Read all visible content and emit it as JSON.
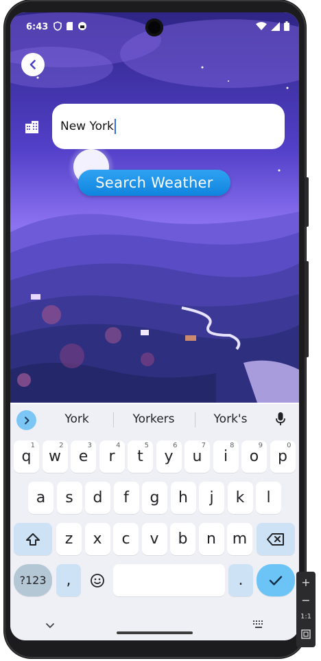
{
  "status_bar": {
    "time": "6:43",
    "left_icons": [
      "shield-icon",
      "sd-card-icon",
      "app-circle-icon"
    ],
    "right_icons": [
      "wifi-icon",
      "signal-icon",
      "battery-icon"
    ]
  },
  "app": {
    "city_input": {
      "value": "New York",
      "placeholder": ""
    },
    "search_button_label": "Search Weather",
    "colors": {
      "button": "#1a93e8",
      "sky_top": "#3b2f9e",
      "sky_mid": "#8a6cf0"
    }
  },
  "keyboard": {
    "suggestions": [
      "York",
      "Yorkers",
      "York's"
    ],
    "rows": [
      [
        {
          "k": "q",
          "h": "1"
        },
        {
          "k": "w",
          "h": "2"
        },
        {
          "k": "e",
          "h": "3"
        },
        {
          "k": "r",
          "h": "4"
        },
        {
          "k": "t",
          "h": "5"
        },
        {
          "k": "y",
          "h": "6"
        },
        {
          "k": "u",
          "h": "7"
        },
        {
          "k": "i",
          "h": "8"
        },
        {
          "k": "o",
          "h": "9"
        },
        {
          "k": "p",
          "h": "0"
        }
      ],
      [
        {
          "k": "a"
        },
        {
          "k": "s"
        },
        {
          "k": "d"
        },
        {
          "k": "f"
        },
        {
          "k": "g"
        },
        {
          "k": "h"
        },
        {
          "k": "j"
        },
        {
          "k": "k"
        },
        {
          "k": "l"
        }
      ],
      [
        {
          "k": "z"
        },
        {
          "k": "x"
        },
        {
          "k": "c"
        },
        {
          "k": "v"
        },
        {
          "k": "b"
        },
        {
          "k": "n"
        },
        {
          "k": "m"
        }
      ]
    ],
    "symbols_label": "?123",
    "comma_label": ",",
    "period_label": ".",
    "emoji_icon": "emoji-icon",
    "shift_icon": "shift-icon",
    "backspace_icon": "backspace-icon",
    "enter_icon": "checkmark-icon"
  },
  "emulator_toolbar": {
    "zoom_in": "+",
    "zoom_out": "−",
    "ratio": "1:1"
  }
}
